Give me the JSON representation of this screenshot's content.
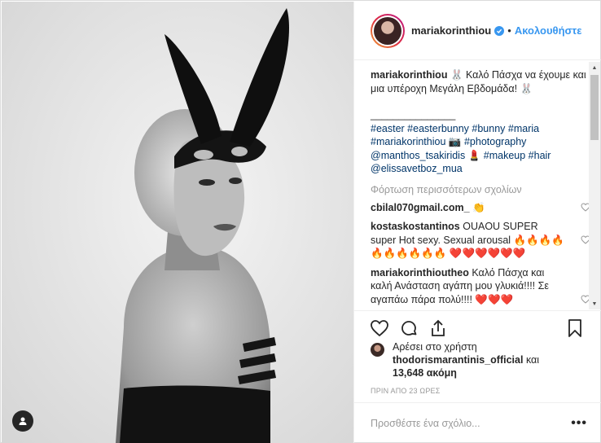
{
  "post": {
    "username": "mariakorinthiou",
    "verified": true,
    "follow_separator": "•",
    "follow_label": "Ακολουθήστε"
  },
  "caption": {
    "username": "mariakorinthiou",
    "line1": "🐰 Καλό Πάσχα να έχουμε και μια υπέροχη Μεγάλη Εβδομάδα! 🐰",
    "divider": "_______________",
    "tags_line1": "#easter #easterbunny #bunny #maria",
    "tags_line2_a": "#mariakorinthiou",
    "tags_line2_b": "📷",
    "tags_line2_c": "#photography",
    "tags_line3_a": "@manthos_tsakiridis",
    "tags_line3_b": "💄",
    "tags_line3_c": "#makeup #hair",
    "tags_line4": "@elissavetboz_mua"
  },
  "load_more_label": "Φόρτωση περισσότερων σχολίων",
  "comments": [
    {
      "username": "cbilal070gmail.com_",
      "text": "👏"
    },
    {
      "username": "kostaskostantinos",
      "text": "OUAOU SUPER super Hot sexy. Sexual arousal 🔥🔥🔥🔥🔥🔥🔥🔥🔥🔥",
      "hearts": "❤️❤️❤️❤️❤️❤️"
    },
    {
      "username": "mariakorinthioutheo",
      "text": "Καλό Πάσχα και καλή Ανάσταση αγάπη μου γλυκιά!!!! Σε αγαπάω πάρα πολύ!!!!",
      "hearts": "❤️❤️❤️"
    }
  ],
  "likes": {
    "prefix": "Αρέσει στο χρήστη",
    "user": "thodorismarantinis_official",
    "conjunction": "και",
    "count": "13,648 ακόμη"
  },
  "timestamp": "ΠΡΙΝ ΑΠΟ 23 ΩΡΕΣ",
  "comment_input": {
    "placeholder": "Προσθέστε ένα σχόλιο..."
  },
  "more_label": "•••",
  "icons": {
    "like": "heart-outline-icon",
    "comment": "comment-bubble-icon",
    "share": "share-upload-icon",
    "save": "bookmark-icon",
    "user_tags": "person-icon",
    "verified": "verified-badge-icon"
  },
  "colors": {
    "link_blue": "#3897f0",
    "hashtag": "#003569",
    "muted": "#999999",
    "text": "#262626",
    "heart_red": "#e0162b"
  }
}
